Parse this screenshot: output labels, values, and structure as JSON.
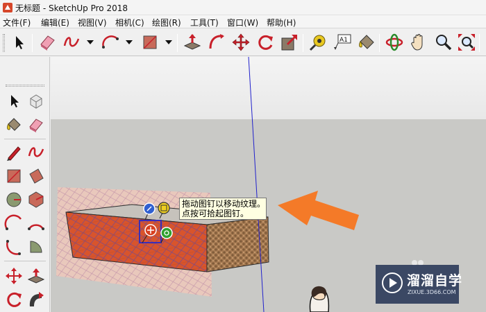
{
  "window": {
    "title": "无标题 - SketchUp Pro 2018",
    "app_icon": "sketchup-logo-icon"
  },
  "menu": [
    {
      "label": "文件(F)"
    },
    {
      "label": "编辑(E)"
    },
    {
      "label": "视图(V)"
    },
    {
      "label": "相机(C)"
    },
    {
      "label": "绘图(R)"
    },
    {
      "label": "工具(T)"
    },
    {
      "label": "窗口(W)"
    },
    {
      "label": "帮助(H)"
    }
  ],
  "toolbar_icons": [
    "select-icon",
    "eraser-icon",
    "freehand-icon",
    "arc-icon",
    "rectangle-icon",
    "push-pull-icon",
    "follow-me-icon",
    "move-icon",
    "rotate-icon",
    "scale-icon",
    "tape-measure-icon",
    "text-icon",
    "paint-bucket-icon",
    "orbit-icon",
    "pan-icon",
    "zoom-icon",
    "zoom-extents-icon"
  ],
  "palette_icons": [
    "select-icon",
    "component-icon",
    "paint-bucket-icon",
    "eraser-icon",
    "pencil-icon",
    "freehand-icon",
    "rectangle-icon",
    "rotated-rectangle-icon",
    "circle-icon",
    "polygon-icon",
    "arc-icon",
    "two-point-arc-icon",
    "three-point-arc-icon",
    "pie-icon",
    "move-icon",
    "push-pull-icon",
    "rotate-icon",
    "follow-me-icon"
  ],
  "tooltip": {
    "line1": "拖动图钉以移动纹理。",
    "line2": "点按可拾起图钉。"
  },
  "watermark": {
    "name": "溜溜自学",
    "url": "ZIXUE.3D66.COM"
  },
  "colors": {
    "sky": "#ececec",
    "ground": "#c9c9c6",
    "brick": "#d8542c",
    "arrow": "#f47a28",
    "selection": "#3a2db8"
  }
}
